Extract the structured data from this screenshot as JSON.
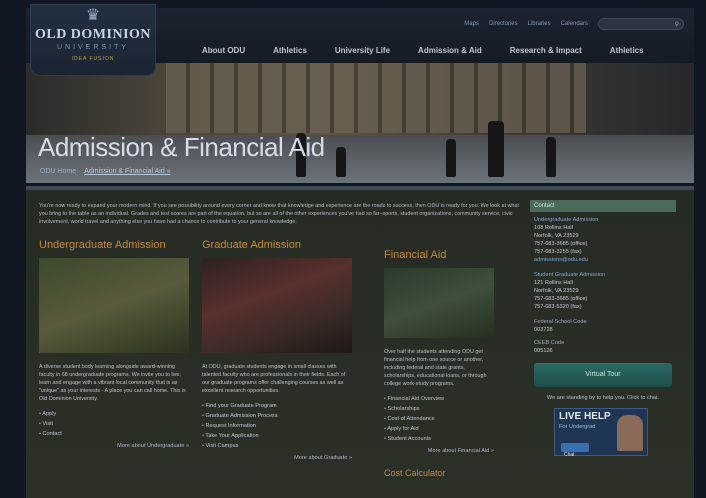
{
  "header": {
    "logo": {
      "name": "OLD DOMINION",
      "sub": "UNIVERSITY",
      "tagline": "IDEA FUSION"
    },
    "utility": [
      "Maps",
      "Directories",
      "Libraries",
      "Calendars"
    ],
    "nav": [
      "About ODU",
      "Athletics",
      "University Life",
      "Admission & Aid",
      "Research & Impact",
      "Athletics"
    ]
  },
  "hero": {
    "title": "Admission & Financial Aid"
  },
  "breadcrumb": {
    "home": "ODU Home",
    "current": "Admission & Financial Aid »"
  },
  "intro": "You're now ready to expand your modern mind. If you see possibility around every corner and know that knowledge and experience are the roads to success, then ODU is ready for you. We look at what you bring to the table as an individual. Grades and test scores are part of the equation, but so are all of the other experiences you've had so far–sports, student organizations, community service, civic involvement, world travel and anything else you have had a chance to contribute to your general knowledge.",
  "columns": [
    {
      "title": "Undergraduate Admission",
      "text": "A diverse student body learning alongside award-winning faculty in 68 undergraduate programs. We invite you to live, learn and engage with a vibrant local community that is as \"unique\" as your interests - A place you can call home. This is Old Dominion University.",
      "links": [
        "Apply",
        "Visit",
        "Contact"
      ],
      "more": "More about Undergraduate »"
    },
    {
      "title": "Graduate Admission",
      "text": "At ODU, graduate students engage in small classes with talented faculty who are professionals in their fields. Each of our graduate programs offer challenging courses as well as excellent research opportunities.",
      "links": [
        "Find your Graduate Program",
        "Graduate Admission Process",
        "Request Information",
        "Take Your Application",
        "Visit Campus"
      ],
      "more": "More about Graduate »"
    },
    {
      "title": "Financial Aid",
      "text": "Over half the students attending ODU get financial help from one source or another, including federal and state grants, scholarships, educational loans, or through college work-study programs.",
      "links": [
        "Financial Aid Overview",
        "Scholarships",
        "Cost of Attendance",
        "Apply for Aid",
        "Student Accounts"
      ],
      "more": "More about Financial Aid »"
    }
  ],
  "sidebar": {
    "head": "Contact",
    "undergrad": [
      "Undergraduate Admission",
      "108 Rollins Hall",
      "Norfolk, VA 23529",
      "757-683-3685 (office)",
      "757-683-3255 (fax)",
      "admissions@odu.edu"
    ],
    "grad": [
      "Student Graduate Admission",
      "121 Rollins Hall",
      "Norfolk, VA 23529",
      "757-683-3685 (office)",
      "757-683-5320 (fax)"
    ],
    "fed_label": "Federal School Code",
    "fed_code": "003728",
    "ceeb_label": "CEEB Code",
    "ceeb_code": "005126",
    "button": "Virtual Tour",
    "note": "We are standing by to help you. Click to chat.",
    "livehelp": {
      "title": "LIVE HELP",
      "subtitle": "For Undergrad",
      "chat": "Chat"
    }
  },
  "fin_more": "Cost Calculator"
}
